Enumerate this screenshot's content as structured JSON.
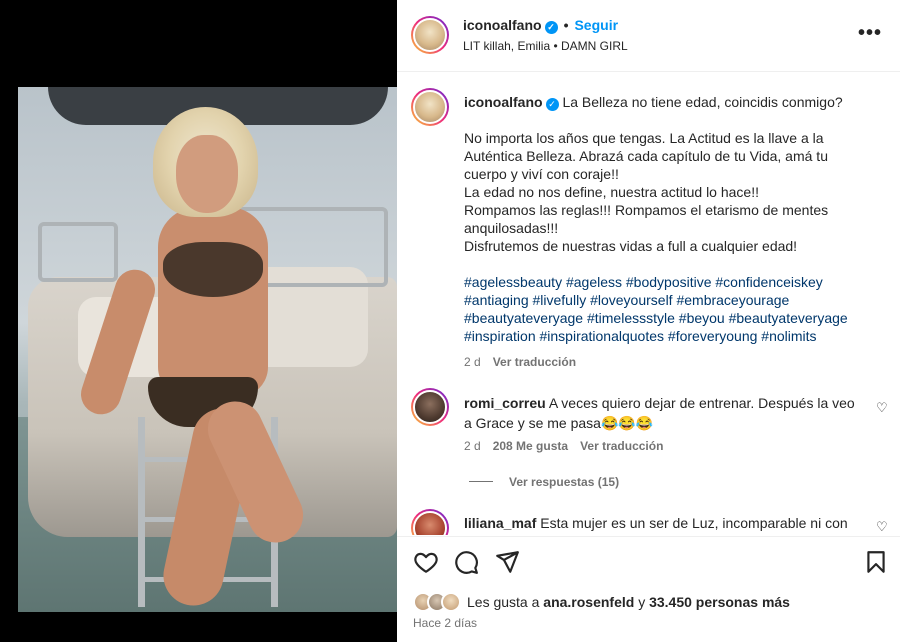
{
  "post": {
    "username": "iconoalfano",
    "follow_label": "Seguir",
    "separator": "•",
    "audio": "LIT killah, Emilia • DAMN GIRL",
    "more_label": "•••"
  },
  "caption": {
    "username": "iconoalfano",
    "title_text": "La Belleza no tiene edad, coincidis conmigo?",
    "paragraph1": "No importa los años que tengas. La Actitud es la llave a la Auténtica Belleza. Abrazá cada capítulo de tu Vida, amá tu cuerpo y viví con coraje!!",
    "line2": "La edad no nos define, nuestra actitud lo hace!!",
    "line3": "Rompamos las reglas!!! Rompamos el etarismo de mentes anquilosadas!!!",
    "line4": "Disfrutemos de nuestras vidas a full a cualquier edad!",
    "hashtags": "#agelessbeauty #ageless #bodypositive #confidenceiskey #antiaging #livefully #loveyourself #embraceyourage #beautyateveryage #timelessstyle #beyou #beautyateveryage #inspiration #inspirationalquotes #foreveryoung #nolimits",
    "age": "2 d",
    "translate_label": "Ver traducción"
  },
  "comments": [
    {
      "username": "romi_correu",
      "text": "A veces quiero dejar de entrenar. Después la veo a Grace y se me pasa😂😂😂",
      "age": "2 d",
      "likes": "208 Me gusta",
      "translate_label": "Ver traducción",
      "replies_label": "Ver respuestas (15)"
    },
    {
      "username": "liliana_maf",
      "text": "Esta mujer es un ser de Luz, incomparable ni con"
    }
  ],
  "footer": {
    "likes_prefix": "Les gusta a",
    "likes_user": "ana.rosenfeld",
    "likes_connector": "y",
    "likes_count": "33.450 personas más",
    "time": "Hace 2 días"
  },
  "icons": {
    "verified": "verified-badge-icon",
    "heart": "heart-icon",
    "comment": "comment-icon",
    "share": "share-icon",
    "save": "bookmark-icon"
  },
  "colors": {
    "accent": "#0095f6",
    "hashtag": "#00376b",
    "muted": "#737373",
    "text": "#262626"
  }
}
